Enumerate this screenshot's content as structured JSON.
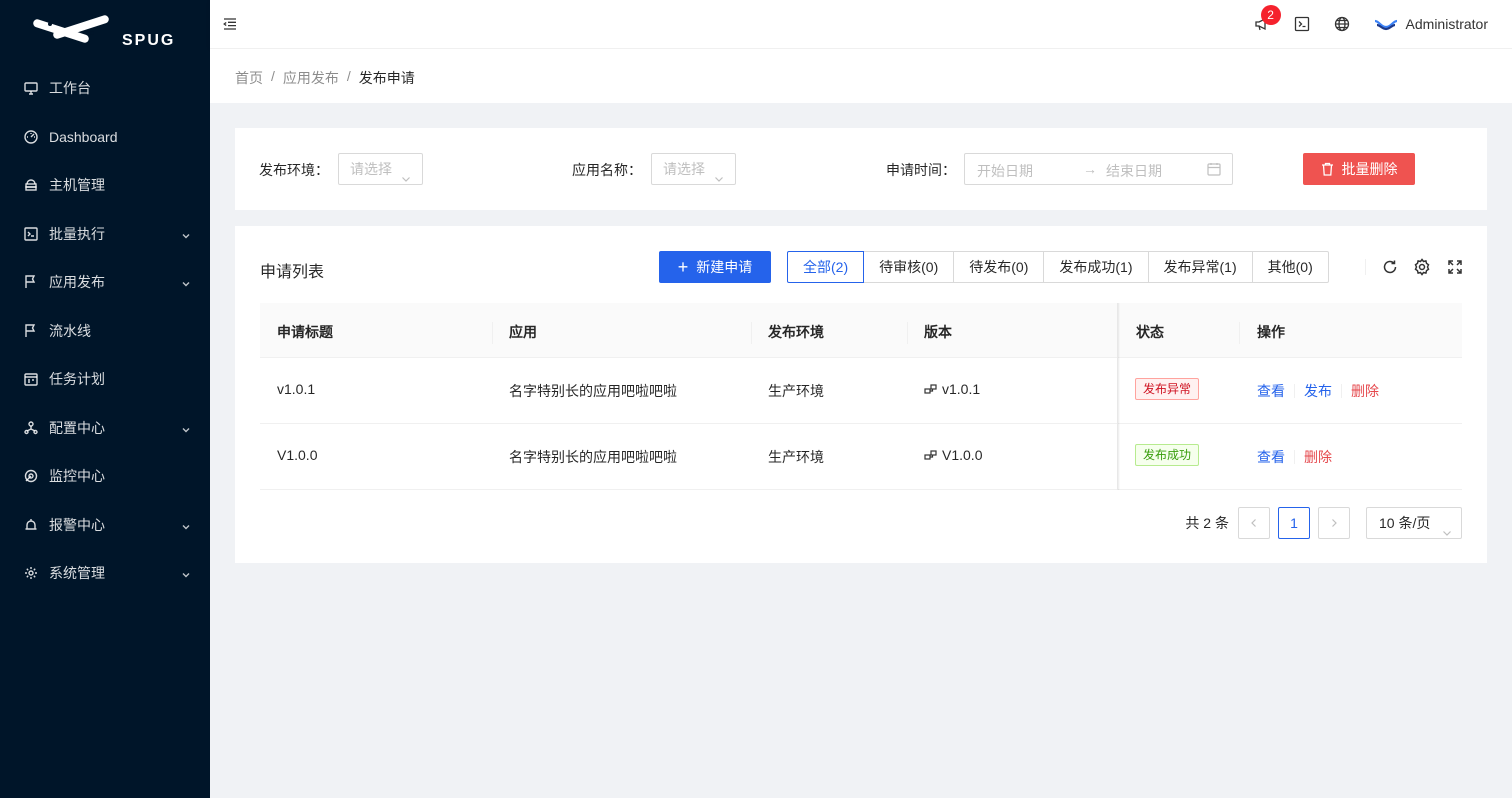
{
  "app": {
    "logo_text": "SPUG"
  },
  "sidebar": {
    "items": [
      {
        "label": "工作台",
        "icon": "desktop-icon",
        "has_children": false
      },
      {
        "label": "Dashboard",
        "icon": "dashboard-icon",
        "has_children": false
      },
      {
        "label": "主机管理",
        "icon": "cloud-server-icon",
        "has_children": false
      },
      {
        "label": "批量执行",
        "icon": "code-icon",
        "has_children": true
      },
      {
        "label": "应用发布",
        "icon": "flag-icon",
        "has_children": true
      },
      {
        "label": "流水线",
        "icon": "flag-icon",
        "has_children": false
      },
      {
        "label": "任务计划",
        "icon": "schedule-icon",
        "has_children": false
      },
      {
        "label": "配置中心",
        "icon": "deployment-icon",
        "has_children": true
      },
      {
        "label": "监控中心",
        "icon": "radar-icon",
        "has_children": false
      },
      {
        "label": "报警中心",
        "icon": "alert-icon",
        "has_children": true
      },
      {
        "label": "系统管理",
        "icon": "setting-icon",
        "has_children": true
      }
    ]
  },
  "header": {
    "notification_count": "2",
    "user_name": "Administrator"
  },
  "breadcrumb": {
    "items": [
      "首页",
      "应用发布",
      "发布申请"
    ],
    "separator": "/"
  },
  "filters": {
    "env_label": "发布环境：",
    "env_placeholder": "请选择",
    "app_label": "应用名称：",
    "app_placeholder": "请选择",
    "time_label": "申请时间：",
    "start_placeholder": "开始日期",
    "end_placeholder": "结束日期",
    "range_arrow": "→",
    "batch_delete": "批量删除"
  },
  "list": {
    "title": "申请列表",
    "new_button": "新建申请",
    "plus": "+",
    "tabs": [
      "全部(2)",
      "待审核(0)",
      "待发布(0)",
      "发布成功(1)",
      "发布异常(1)",
      "其他(0)"
    ],
    "columns": [
      "申请标题",
      "应用",
      "发布环境",
      "版本",
      "状态",
      "操作"
    ],
    "rows": [
      {
        "title": "v1.0.1",
        "app": "名字特别长的应用吧啦吧啦",
        "env": "生产环境",
        "version": "v1.0.1",
        "status": "发布异常",
        "status_type": "error",
        "actions": [
          "查看",
          "发布",
          "删除"
        ]
      },
      {
        "title": "V1.0.0",
        "app": "名字特别长的应用吧啦吧啦",
        "env": "生产环境",
        "version": "V1.0.0",
        "status": "发布成功",
        "status_type": "success",
        "actions": [
          "查看",
          "删除"
        ]
      }
    ]
  },
  "pagination": {
    "total": "共 2 条",
    "current": "1",
    "prev": "<",
    "next": ">",
    "page_size": "10 条/页"
  },
  "colors": {
    "primary": "#2563eb",
    "danger": "#ef5350",
    "sidebar_bg": "#001529"
  }
}
